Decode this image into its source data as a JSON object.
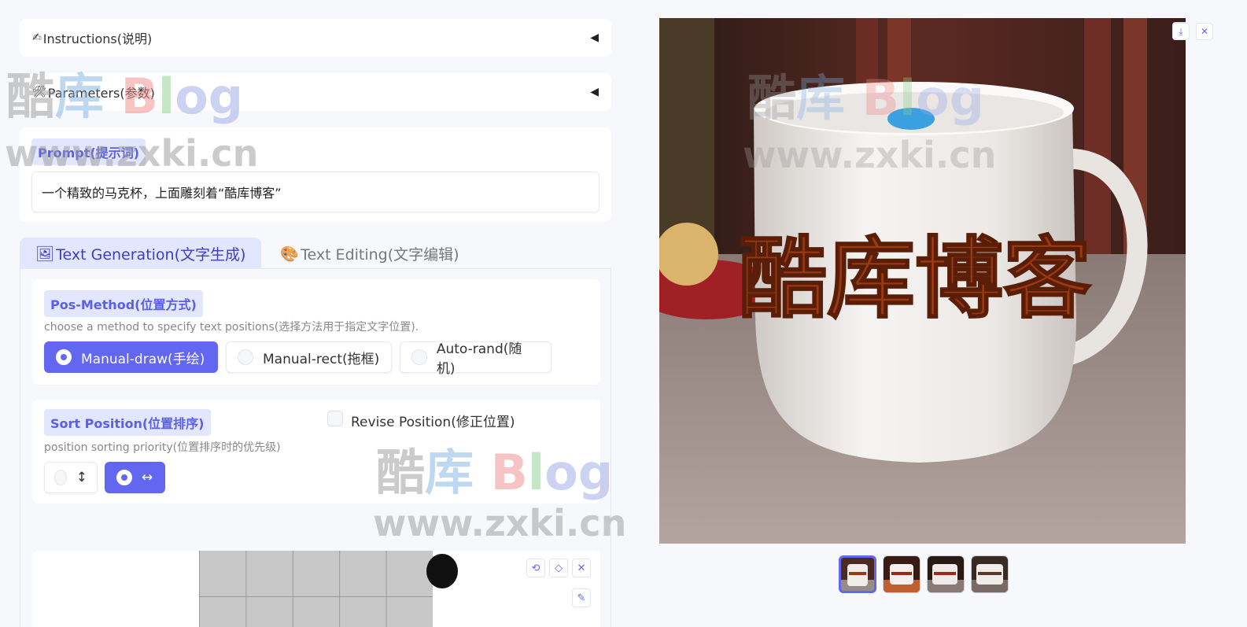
{
  "instructions": {
    "label": "Instructions(说明)",
    "icon": "✍"
  },
  "parameters": {
    "label": "Parameters(参数)",
    "icon": "🛠"
  },
  "prompt": {
    "label": "Prompt(提示词)",
    "value": "一个精致的马克杯，上面雕刻着“酷库博客”"
  },
  "tabs": [
    {
      "label": "Text Generation(文字生成)",
      "icon": "🖼",
      "active": true
    },
    {
      "label": "Text Editing(文字编辑)",
      "icon": "🎨",
      "active": false
    }
  ],
  "pos_method": {
    "label": "Pos-Method(位置方式)",
    "hint": "choose a method to specify text positions(选择方法用于指定文字位置).",
    "options": [
      "Manual-draw(手绘)",
      "Manual-rect(拖框)",
      "Auto-rand(随机)"
    ],
    "selected": "Manual-draw(手绘)"
  },
  "sort_position": {
    "label": "Sort Position(位置排序)",
    "hint": "position sorting priority(位置排序时的优先级)",
    "options": [
      "↕",
      "↔"
    ],
    "selected": "↔"
  },
  "revise_position": {
    "label": "Revise Position(修正位置)",
    "checked": false
  },
  "result_image": {
    "engraved_text": "酷库博客"
  },
  "watermark": {
    "chars": [
      "酷",
      "库",
      "B",
      "l",
      "og"
    ],
    "url": "www.zxki.cn"
  },
  "colors": {
    "accent": "#6366f1",
    "badge_bg": "#e3e6ff"
  }
}
